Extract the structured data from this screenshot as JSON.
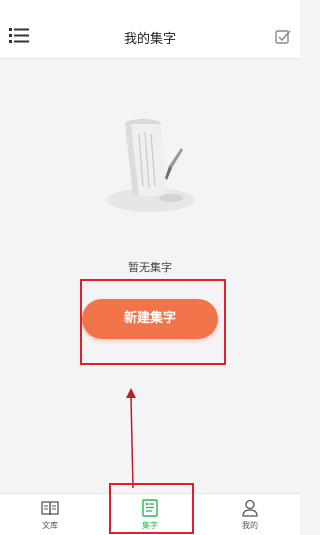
{
  "header": {
    "title": "我的集字",
    "menu_icon": "list-menu-icon",
    "edit_icon": "checkbox-edit-icon"
  },
  "empty_state": {
    "illustration_icon": "scroll-with-brush-icon",
    "text": "暂无集字"
  },
  "new_button": {
    "label": "新建集字",
    "color": "#f2744a"
  },
  "annotation": {
    "color": "#e0202a"
  },
  "tabbar": {
    "active_color": "#2bb54e",
    "tabs": [
      {
        "label": "文库",
        "icon": "open-book-icon",
        "active": false
      },
      {
        "label": "集字",
        "icon": "document-icon",
        "active": true
      },
      {
        "label": "我的",
        "icon": "person-icon",
        "active": false
      }
    ]
  }
}
